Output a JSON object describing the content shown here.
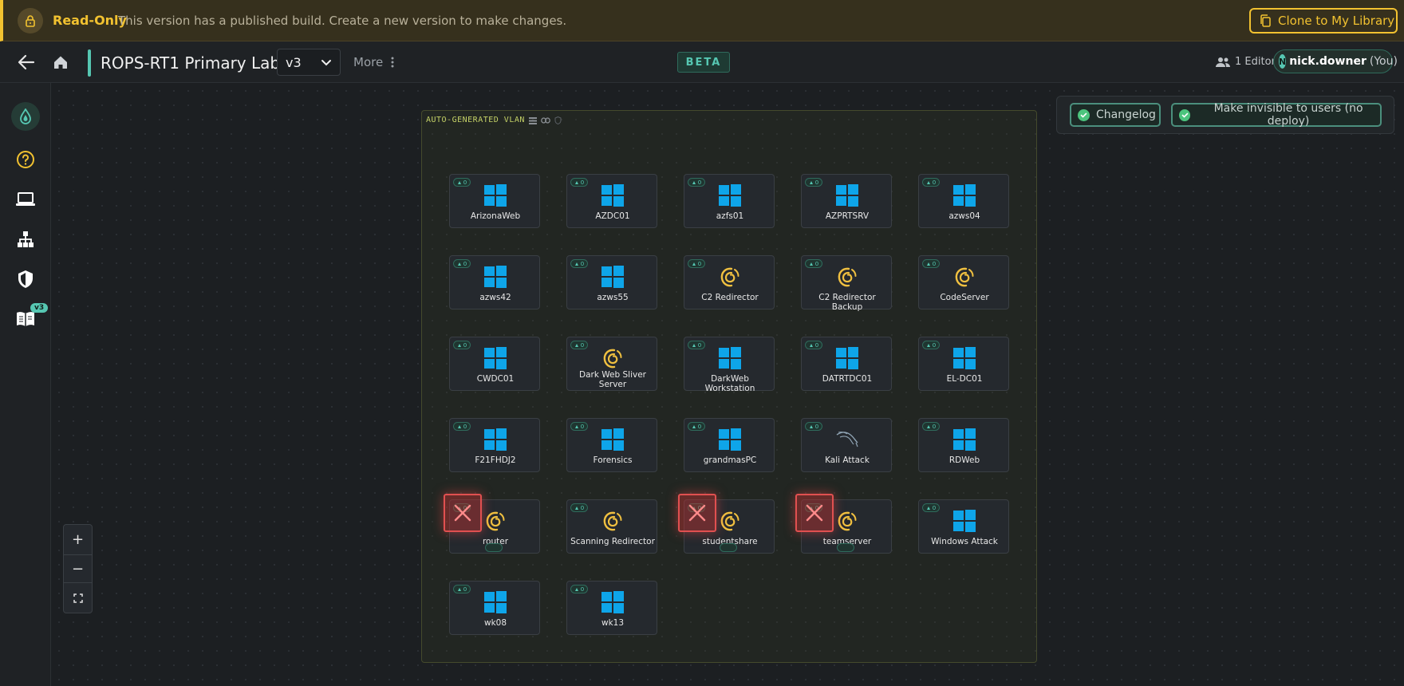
{
  "banner": {
    "status": "Read-Only",
    "message": "This version has a published build. Create a new version to make changes.",
    "clone_label": "Clone to My Library",
    "accent": "#f2c230"
  },
  "header": {
    "title": "ROPS-RT1 Primary Lab",
    "version": "v3",
    "more_label": "More",
    "beta": "BETA",
    "editors": "1 Editor",
    "user_initial": "N",
    "user_name": "nick.downer",
    "user_suffix": "(You)"
  },
  "sidebar": {
    "badge": "v3",
    "icons": [
      "droplet-logo-icon",
      "help-icon",
      "laptop-icon",
      "network-icon",
      "shield-icon",
      "book-icon"
    ]
  },
  "vlan": {
    "label": "AUTO-GENERATED VLAN"
  },
  "toggles": {
    "changelog": "Changelog",
    "invisible": "Make invisible to users (no deploy)"
  },
  "zoom": {
    "in": "+",
    "out": "−"
  },
  "colors": {
    "accent": "#56c7b2",
    "windows": "#0ea5e9",
    "debian": "#f0c040",
    "error": "#e05050"
  },
  "nodes": [
    {
      "name": "ArizonaWeb",
      "os": "windows",
      "chip": "0",
      "error": false
    },
    {
      "name": "AZDC01",
      "os": "windows",
      "chip": "0",
      "error": false
    },
    {
      "name": "azfs01",
      "os": "windows",
      "chip": "0",
      "error": false
    },
    {
      "name": "AZPRTSRV",
      "os": "windows",
      "chip": "0",
      "error": false
    },
    {
      "name": "azws04",
      "os": "windows",
      "chip": "0",
      "error": false
    },
    {
      "name": "azws42",
      "os": "windows",
      "chip": "0",
      "error": false
    },
    {
      "name": "azws55",
      "os": "windows",
      "chip": "0",
      "error": false
    },
    {
      "name": "C2 Redirector",
      "os": "debian",
      "chip": "0",
      "error": false
    },
    {
      "name": "C2 Redirector Backup",
      "os": "debian",
      "chip": "0",
      "error": false
    },
    {
      "name": "CodeServer",
      "os": "debian",
      "chip": "0",
      "error": false
    },
    {
      "name": "CWDC01",
      "os": "windows",
      "chip": "0",
      "error": false
    },
    {
      "name": "Dark Web Sliver Server",
      "os": "debian",
      "chip": "0",
      "error": false
    },
    {
      "name": "DarkWeb Workstation",
      "os": "windows",
      "chip": "0",
      "error": false
    },
    {
      "name": "DATRTDC01",
      "os": "windows",
      "chip": "0",
      "error": false
    },
    {
      "name": "EL-DC01",
      "os": "windows",
      "chip": "0",
      "error": false
    },
    {
      "name": "F21FHDJ2",
      "os": "windows",
      "chip": "0",
      "error": false
    },
    {
      "name": "Forensics",
      "os": "windows",
      "chip": "0",
      "error": false
    },
    {
      "name": "grandmasPC",
      "os": "windows",
      "chip": "0",
      "error": false
    },
    {
      "name": "Kali Attack",
      "os": "kali",
      "chip": "0",
      "error": false
    },
    {
      "name": "RDWeb",
      "os": "windows",
      "chip": "0",
      "error": false
    },
    {
      "name": "router",
      "os": "debian",
      "chip": "0",
      "error": true
    },
    {
      "name": "Scanning Redirector",
      "os": "debian",
      "chip": "0",
      "error": false
    },
    {
      "name": "studentshare",
      "os": "debian",
      "chip": "0",
      "error": true
    },
    {
      "name": "teamserver",
      "os": "debian",
      "chip": "0",
      "error": true
    },
    {
      "name": "Windows Attack",
      "os": "windows",
      "chip": "0",
      "error": false
    },
    {
      "name": "wk08",
      "os": "windows",
      "chip": "0",
      "error": false
    },
    {
      "name": "wk13",
      "os": "windows",
      "chip": "0",
      "error": false
    }
  ]
}
